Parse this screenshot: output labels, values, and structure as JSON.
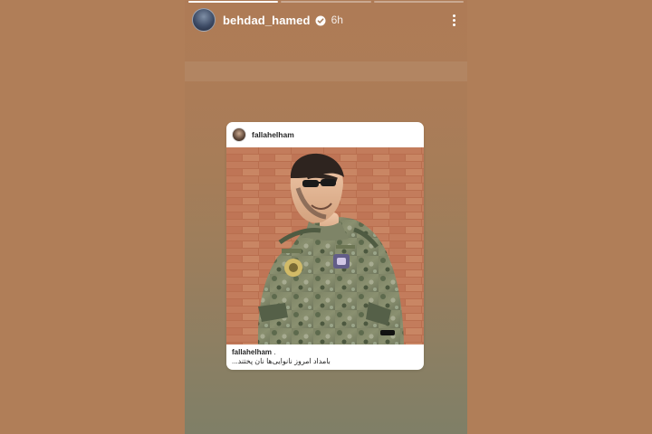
{
  "story": {
    "username": "behdad_hamed",
    "verified": true,
    "time": "6h",
    "progress": {
      "segments": 3,
      "completed": 1
    },
    "icons": {
      "more": "more-vertical-icon",
      "verified": "verified-badge-icon"
    }
  },
  "post": {
    "username": "fallahelham",
    "caption_user": "fallahelham",
    "caption_user_suffix": " .",
    "caption_text": "بامداد امروز نانوایی‌ها نان پختند..."
  },
  "colors": {
    "background": "#b07e58",
    "story_top": "#ae7b56",
    "story_bottom": "#7f7f67",
    "verified_blue": "#ffffff",
    "card": "#ffffff"
  }
}
